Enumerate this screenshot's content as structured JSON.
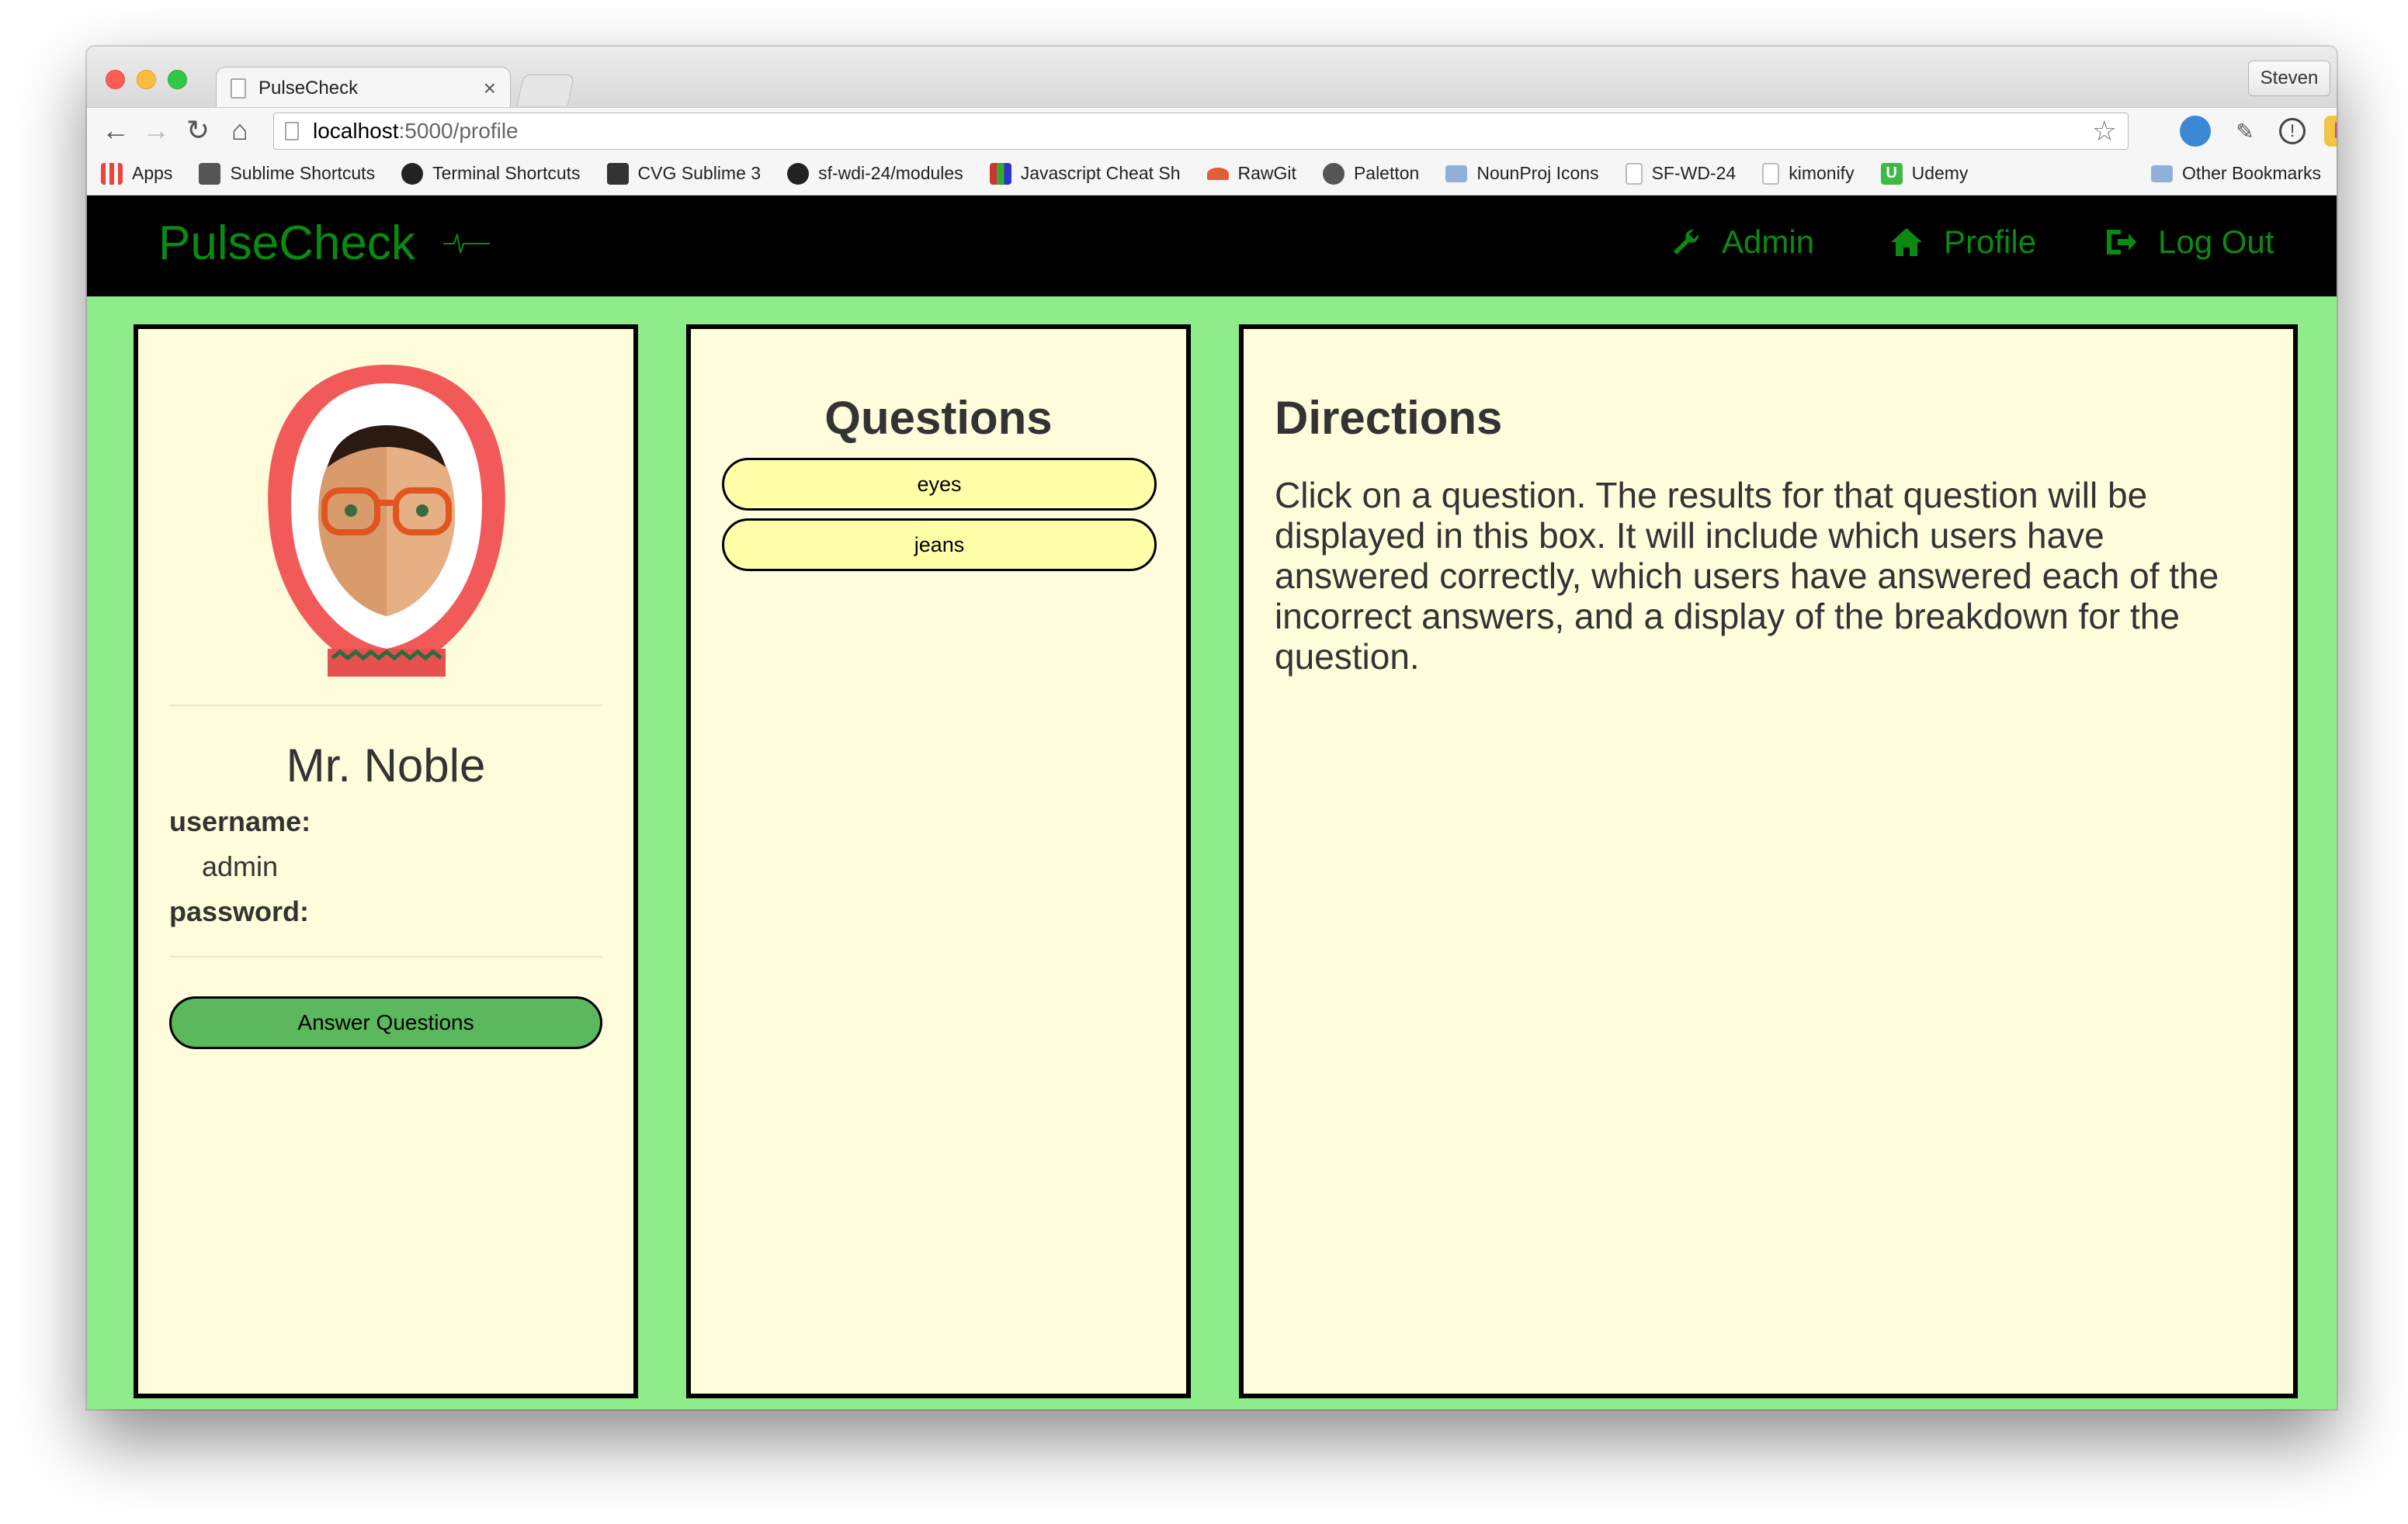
{
  "browser": {
    "tab_title": "PulseCheck",
    "tab_close": "×",
    "profile_name": "Steven",
    "url_host": "localhost",
    "url_path": ":5000/profile",
    "bookmarks": [
      {
        "label": "Apps",
        "icon": "apps-grid-icon",
        "color": "#e8453c"
      },
      {
        "label": "Sublime Shortcuts",
        "icon": "document-icon",
        "color": "#555555"
      },
      {
        "label": "Terminal Shortcuts",
        "icon": "github-icon",
        "color": "#222222"
      },
      {
        "label": "CVG Sublime 3",
        "icon": "sublime-icon",
        "color": "#333333"
      },
      {
        "label": "sf-wdi-24/modules",
        "icon": "github-icon",
        "color": "#222222"
      },
      {
        "label": "Javascript Cheat Sh",
        "icon": "books-icon",
        "color": "#aa3322"
      },
      {
        "label": "RawGit",
        "icon": "rawgit-icon",
        "color": "#e35d3a"
      },
      {
        "label": "Paletton",
        "icon": "paletton-icon",
        "color": "#555555"
      },
      {
        "label": "NounProj Icons",
        "icon": "folder-icon",
        "color": "#8fb1d9"
      },
      {
        "label": "SF-WD-24",
        "icon": "page-icon",
        "color": "#bbbbbb"
      },
      {
        "label": "kimonify",
        "icon": "page-icon",
        "color": "#bbbbbb"
      },
      {
        "label": "Udemy",
        "icon": "udemy-icon",
        "color": "#3db946"
      }
    ],
    "other_bookmarks": "Other Bookmarks"
  },
  "app": {
    "brand": "PulseCheck",
    "nav": {
      "admin": "Admin",
      "profile": "Profile",
      "logout": "Log Out"
    },
    "accent_color": "#0a8a12",
    "background_color": "#8eec8a",
    "panel_color": "#fefcdb"
  },
  "profile": {
    "name": "Mr. Noble",
    "username_label": "username:",
    "username_value": "admin",
    "password_label": "password:",
    "answer_button": "Answer Questions"
  },
  "questions": {
    "title": "Questions",
    "items": [
      "eyes",
      "jeans"
    ]
  },
  "directions": {
    "title": "Directions",
    "text": "Click on a question. The results for that question will be displayed in this box. It will include which users have answered correctly, which users have answered each of the incorrect answers, and a display of the breakdown for the question."
  }
}
